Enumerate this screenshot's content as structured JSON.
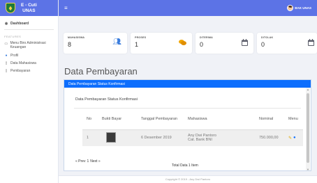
{
  "brand": {
    "line1": "E - Cuti",
    "line2": "UNAS"
  },
  "sidebar": {
    "dashboard": "Dashboard",
    "heading": "FEATURES",
    "items": [
      {
        "label": "Menu Biro Administrasi Keuangan",
        "icon": "document-icon"
      },
      {
        "label": "Profil",
        "icon": "user-icon"
      },
      {
        "label": "Data Mahasiswa",
        "icon": "file-icon"
      },
      {
        "label": "Pembayaran",
        "icon": "file-icon"
      }
    ]
  },
  "topbar": {
    "user_name": "BAK UNAS"
  },
  "cards": [
    {
      "label": "MAHASISWA",
      "value": "8",
      "icon": "users-icon",
      "color": "#3b7ddd"
    },
    {
      "label": "PROSES",
      "value": "1",
      "icon": "comments-icon",
      "color": "#f0a500"
    },
    {
      "label": "DITERIMA",
      "value": "0",
      "icon": "calendar-icon",
      "color": "#5a5c69"
    },
    {
      "label": "DITOLAK",
      "value": "0",
      "icon": "calendar-icon",
      "color": "#5a5c69"
    }
  ],
  "page_title": "Data Pembayaran",
  "panel": {
    "header": "Data Pembayaran Status Konfirmasi",
    "subtitle": "Data Pembayaran Status Konfirmasi",
    "columns": {
      "no": "No",
      "bukti": "Bukti Bayar",
      "tanggal": "Tanggal Pembayaran",
      "mahasiswa": "Mahasiswa",
      "nominal": "Nominal",
      "menu": "Menu"
    },
    "rows": [
      {
        "no": "1",
        "tanggal": "6 Desember 2019",
        "mahasiswa_name": "Any Dwi Pantoro",
        "mahasiswa_bank": "Cat. Bank BNI",
        "nominal": "750.000,00"
      }
    ],
    "pager": {
      "prev": "« Prev",
      "page": "1",
      "next": "Next »"
    },
    "total": "Total Data 1 Item"
  },
  "footer": "Copyright © 2019 - Any Dwi Pantoro",
  "colors": {
    "primary": "#5c73e6",
    "panel_header": "#0d6efd"
  }
}
